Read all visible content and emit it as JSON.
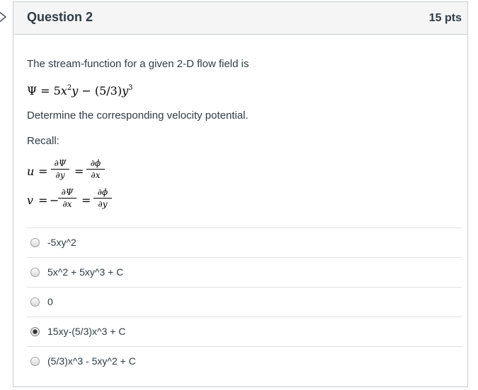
{
  "question": {
    "title": "Question 2",
    "points": "15 pts",
    "prompt": "The stream-function for a given 2-D flow field is",
    "stream_function": {
      "lhs": "Ψ",
      "eq": "=",
      "c1": "5",
      "x": "x",
      "x_exp": "2",
      "y1": "y",
      "minus": "−",
      "c2": "(5/3)",
      "y2": "y",
      "y_exp": "3"
    },
    "instruction": "Determine the corresponding velocity potential.",
    "recall_label": "Recall:",
    "recall": {
      "u": {
        "lhs": "u",
        "eq1": "=",
        "sign": "",
        "frac1_num": "∂Ψ",
        "frac1_den": "∂y",
        "eq2": "=",
        "frac2_num": "∂ϕ",
        "frac2_den": "∂x"
      },
      "v": {
        "lhs": "v",
        "eq1": "=",
        "sign": "−",
        "frac1_num": "∂Ψ",
        "frac1_den": "∂x",
        "eq2": "=",
        "frac2_num": "∂ϕ",
        "frac2_den": "∂y"
      }
    },
    "answers": [
      {
        "label": "-5xy^2",
        "selected": false
      },
      {
        "label": "5x^2 + 5xy^3 + C",
        "selected": false
      },
      {
        "label": "0",
        "selected": false
      },
      {
        "label": "15xy-(5/3)x^3 + C",
        "selected": true
      },
      {
        "label": "(5/3)x^3 - 5xy^2 + C",
        "selected": false
      }
    ]
  },
  "icons": {
    "nav": "chevron-right-icon"
  },
  "colors": {
    "text": "#2d3b45",
    "header_bg": "#f5f5f5",
    "border": "#c7cdd1"
  }
}
